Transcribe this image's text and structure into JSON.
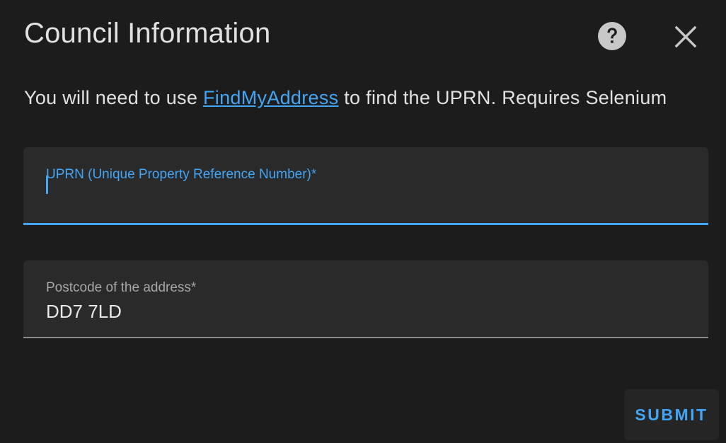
{
  "dialog": {
    "title": "Council Information"
  },
  "description": {
    "prefix": "You will need to use ",
    "link_text": "FindMyAddress",
    "suffix": " to find the UPRN. Requires Selenium"
  },
  "fields": {
    "uprn": {
      "label": "UPRN (Unique Property Reference Number)*",
      "value": ""
    },
    "postcode": {
      "label": "Postcode of the address*",
      "value": "DD7 7LD"
    }
  },
  "actions": {
    "submit_label": "SUBMIT"
  },
  "icons": {
    "help": "help-circle-icon",
    "close": "close-icon"
  },
  "colors": {
    "background": "#1c1c1c",
    "field_background": "#2a2a2a",
    "accent": "#42a5f5",
    "text": "#e1e1e1",
    "muted_label": "#a8a8a8"
  }
}
